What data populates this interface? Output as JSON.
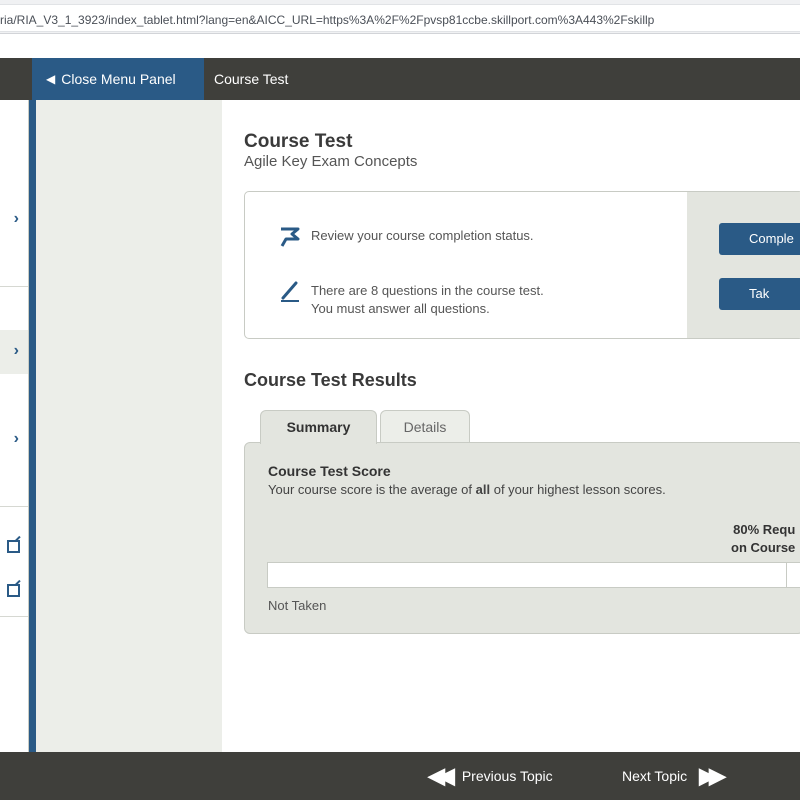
{
  "browser": {
    "url": "ria/RIA_V3_1_3923/index_tablet.html?lang=en&AICC_URL=https%3A%2F%2Fpvsp81ccbe.skillport.com%3A443%2Fskillp"
  },
  "topnav": {
    "close_menu_label": "Close Menu Panel",
    "breadcrumb": "Course Test"
  },
  "course": {
    "title": "Course Test",
    "subtitle": "Agile Key Exam Concepts"
  },
  "info": {
    "status_message": "Review your course completion status.",
    "questions_line1": "There are 8 questions in the course test.",
    "questions_line2": "You must answer all questions.",
    "completion_button": "Comple",
    "take_button": "Tak"
  },
  "results": {
    "title": "Course Test Results",
    "tabs": {
      "summary": "Summary",
      "details": "Details"
    },
    "score_title": "Course Test Score",
    "score_desc_before": "Your course score is the average of ",
    "score_desc_bold": "all",
    "score_desc_after": " of your highest lesson scores.",
    "required_line1": "80% Requ",
    "required_line2": "on Course",
    "status": "Not Taken"
  },
  "footer": {
    "previous_topic": "Previous Topic",
    "next_topic": "Next Topic"
  },
  "colors": {
    "accent": "#2a5a86",
    "header_bar": "#3f3f3b",
    "panel_bg": "#e3e5df"
  }
}
